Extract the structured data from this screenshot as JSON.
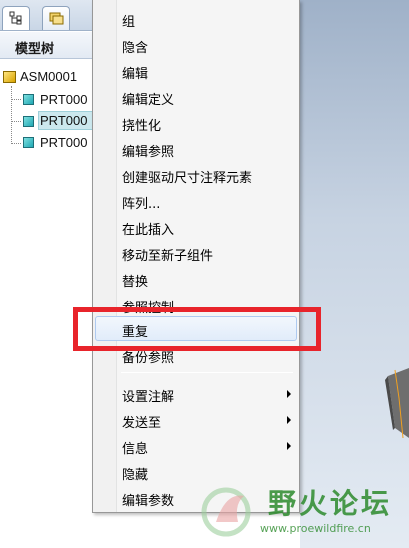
{
  "model_tree": {
    "title": "模型树",
    "tabs": [
      {
        "name": "model-tree-tab"
      },
      {
        "name": "layer-tree-tab"
      }
    ],
    "root": "ASM0001",
    "children": [
      "PRT000",
      "PRT000",
      "PRT000"
    ],
    "selected_index": 1
  },
  "context_menu": {
    "items": [
      {
        "label": "组"
      },
      {
        "label": "隐含"
      },
      {
        "label": "编辑"
      },
      {
        "label": "编辑定义"
      },
      {
        "label": "挠性化"
      },
      {
        "label": "编辑参照"
      },
      {
        "label": "创建驱动尺寸注释元素"
      },
      {
        "label": "阵列..."
      },
      {
        "label": "在此插入"
      },
      {
        "label": "移动至新子组件"
      },
      {
        "label": "替换"
      },
      {
        "label": "参照控制"
      },
      {
        "label": "重复"
      },
      {
        "label": "备份参照"
      },
      {
        "label": "设置注解",
        "submenu": true
      },
      {
        "label": "发送至",
        "submenu": true
      },
      {
        "label": "信息",
        "submenu": true
      },
      {
        "label": "隐藏"
      },
      {
        "label": "编辑参数"
      }
    ],
    "highlighted_label": "重复"
  },
  "watermark": {
    "title": "野火论坛",
    "url": "www.proewildfire.cn"
  },
  "colors": {
    "highlight_border": "#e8242b",
    "watermark": "#2d8b2d",
    "selection": "#cce8ee"
  }
}
